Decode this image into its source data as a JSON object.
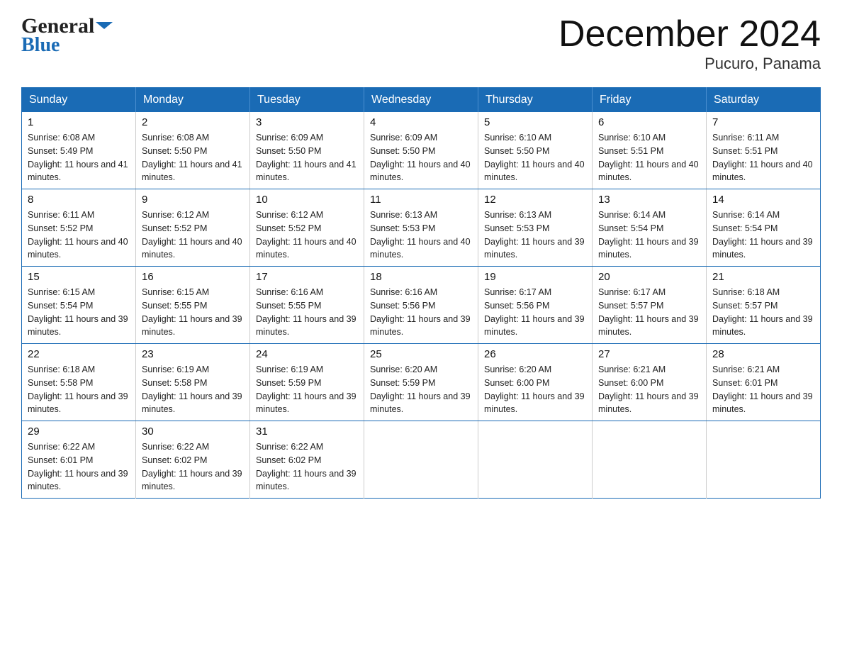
{
  "header": {
    "logo_line1": "General",
    "logo_line2": "Blue",
    "title": "December 2024",
    "subtitle": "Pucuro, Panama"
  },
  "calendar": {
    "days_of_week": [
      "Sunday",
      "Monday",
      "Tuesday",
      "Wednesday",
      "Thursday",
      "Friday",
      "Saturday"
    ],
    "weeks": [
      [
        {
          "day": "1",
          "sunrise": "6:08 AM",
          "sunset": "5:49 PM",
          "daylight": "11 hours and 41 minutes."
        },
        {
          "day": "2",
          "sunrise": "6:08 AM",
          "sunset": "5:50 PM",
          "daylight": "11 hours and 41 minutes."
        },
        {
          "day": "3",
          "sunrise": "6:09 AM",
          "sunset": "5:50 PM",
          "daylight": "11 hours and 41 minutes."
        },
        {
          "day": "4",
          "sunrise": "6:09 AM",
          "sunset": "5:50 PM",
          "daylight": "11 hours and 40 minutes."
        },
        {
          "day": "5",
          "sunrise": "6:10 AM",
          "sunset": "5:50 PM",
          "daylight": "11 hours and 40 minutes."
        },
        {
          "day": "6",
          "sunrise": "6:10 AM",
          "sunset": "5:51 PM",
          "daylight": "11 hours and 40 minutes."
        },
        {
          "day": "7",
          "sunrise": "6:11 AM",
          "sunset": "5:51 PM",
          "daylight": "11 hours and 40 minutes."
        }
      ],
      [
        {
          "day": "8",
          "sunrise": "6:11 AM",
          "sunset": "5:52 PM",
          "daylight": "11 hours and 40 minutes."
        },
        {
          "day": "9",
          "sunrise": "6:12 AM",
          "sunset": "5:52 PM",
          "daylight": "11 hours and 40 minutes."
        },
        {
          "day": "10",
          "sunrise": "6:12 AM",
          "sunset": "5:52 PM",
          "daylight": "11 hours and 40 minutes."
        },
        {
          "day": "11",
          "sunrise": "6:13 AM",
          "sunset": "5:53 PM",
          "daylight": "11 hours and 40 minutes."
        },
        {
          "day": "12",
          "sunrise": "6:13 AM",
          "sunset": "5:53 PM",
          "daylight": "11 hours and 39 minutes."
        },
        {
          "day": "13",
          "sunrise": "6:14 AM",
          "sunset": "5:54 PM",
          "daylight": "11 hours and 39 minutes."
        },
        {
          "day": "14",
          "sunrise": "6:14 AM",
          "sunset": "5:54 PM",
          "daylight": "11 hours and 39 minutes."
        }
      ],
      [
        {
          "day": "15",
          "sunrise": "6:15 AM",
          "sunset": "5:54 PM",
          "daylight": "11 hours and 39 minutes."
        },
        {
          "day": "16",
          "sunrise": "6:15 AM",
          "sunset": "5:55 PM",
          "daylight": "11 hours and 39 minutes."
        },
        {
          "day": "17",
          "sunrise": "6:16 AM",
          "sunset": "5:55 PM",
          "daylight": "11 hours and 39 minutes."
        },
        {
          "day": "18",
          "sunrise": "6:16 AM",
          "sunset": "5:56 PM",
          "daylight": "11 hours and 39 minutes."
        },
        {
          "day": "19",
          "sunrise": "6:17 AM",
          "sunset": "5:56 PM",
          "daylight": "11 hours and 39 minutes."
        },
        {
          "day": "20",
          "sunrise": "6:17 AM",
          "sunset": "5:57 PM",
          "daylight": "11 hours and 39 minutes."
        },
        {
          "day": "21",
          "sunrise": "6:18 AM",
          "sunset": "5:57 PM",
          "daylight": "11 hours and 39 minutes."
        }
      ],
      [
        {
          "day": "22",
          "sunrise": "6:18 AM",
          "sunset": "5:58 PM",
          "daylight": "11 hours and 39 minutes."
        },
        {
          "day": "23",
          "sunrise": "6:19 AM",
          "sunset": "5:58 PM",
          "daylight": "11 hours and 39 minutes."
        },
        {
          "day": "24",
          "sunrise": "6:19 AM",
          "sunset": "5:59 PM",
          "daylight": "11 hours and 39 minutes."
        },
        {
          "day": "25",
          "sunrise": "6:20 AM",
          "sunset": "5:59 PM",
          "daylight": "11 hours and 39 minutes."
        },
        {
          "day": "26",
          "sunrise": "6:20 AM",
          "sunset": "6:00 PM",
          "daylight": "11 hours and 39 minutes."
        },
        {
          "day": "27",
          "sunrise": "6:21 AM",
          "sunset": "6:00 PM",
          "daylight": "11 hours and 39 minutes."
        },
        {
          "day": "28",
          "sunrise": "6:21 AM",
          "sunset": "6:01 PM",
          "daylight": "11 hours and 39 minutes."
        }
      ],
      [
        {
          "day": "29",
          "sunrise": "6:22 AM",
          "sunset": "6:01 PM",
          "daylight": "11 hours and 39 minutes."
        },
        {
          "day": "30",
          "sunrise": "6:22 AM",
          "sunset": "6:02 PM",
          "daylight": "11 hours and 39 minutes."
        },
        {
          "day": "31",
          "sunrise": "6:22 AM",
          "sunset": "6:02 PM",
          "daylight": "11 hours and 39 minutes."
        },
        null,
        null,
        null,
        null
      ]
    ]
  }
}
